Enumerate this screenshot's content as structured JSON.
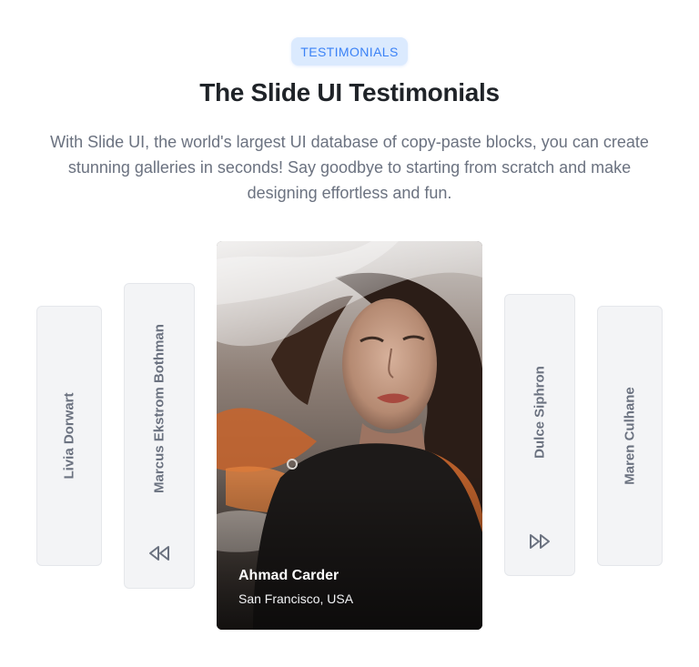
{
  "header": {
    "badge": "TESTIMONIALS",
    "title": "The Slide UI Testimonials",
    "description": "With Slide UI, the world's largest UI database of copy-paste blocks, you can create stunning galleries in seconds! Say goodbye to starting from scratch and make designing effortless and fun."
  },
  "carousel": {
    "cards": [
      {
        "name": "Livia Dorwart"
      },
      {
        "name": "Marcus Ekstrom Bothman",
        "icon": "rewind-icon"
      },
      {
        "name": "Ahmad Carder",
        "location": "San Francisco, USA",
        "active": true
      },
      {
        "name": "Dulce Siphron",
        "icon": "fast-forward-icon"
      },
      {
        "name": "Maren Culhane"
      }
    ]
  },
  "colors": {
    "accent": "#3b82f6",
    "badge_bg": "#dbeafe",
    "title": "#1f2328",
    "muted_text": "#6b7280",
    "card_bg": "#f3f4f6"
  }
}
